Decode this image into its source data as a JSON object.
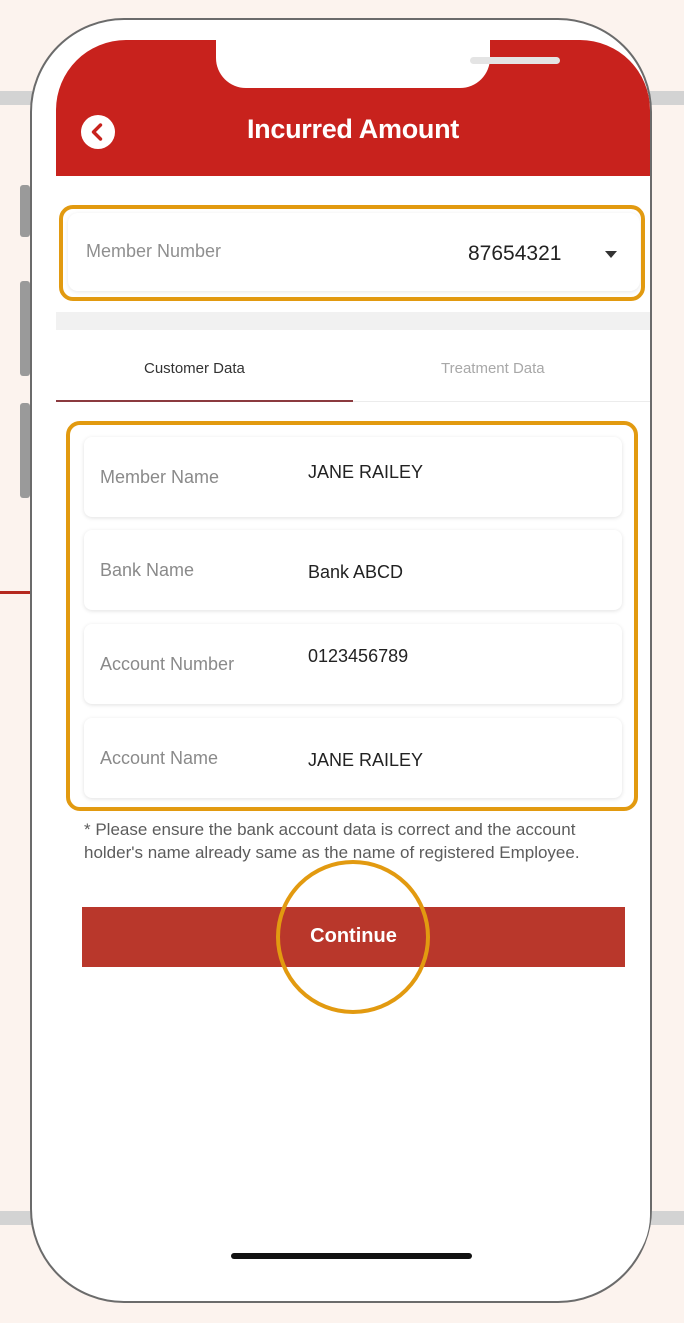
{
  "header": {
    "title": "Incurred Amount",
    "back_icon": "chevron-left-icon"
  },
  "member_selector": {
    "label": "Member Number",
    "value": "87654321",
    "icon": "caret-down-icon"
  },
  "tabs": [
    {
      "label": "Customer Data",
      "active": true
    },
    {
      "label": "Treatment Data",
      "active": false
    }
  ],
  "customer_fields": [
    {
      "label": "Member Name",
      "value": "JANE RAILEY"
    },
    {
      "label": "Bank Name",
      "value": "Bank ABCD"
    },
    {
      "label": "Account Number",
      "value": "0123456789"
    },
    {
      "label": "Account Name",
      "value": "JANE RAILEY"
    }
  ],
  "note": "* Please ensure the bank account data is correct and the account holder's name already same as the name of registered Employee.",
  "continue_label": "Continue",
  "colors": {
    "brand_red": "#c8221d",
    "button_red": "#b9372b",
    "highlight": "#e29a10",
    "background": "#fcf3ee"
  }
}
